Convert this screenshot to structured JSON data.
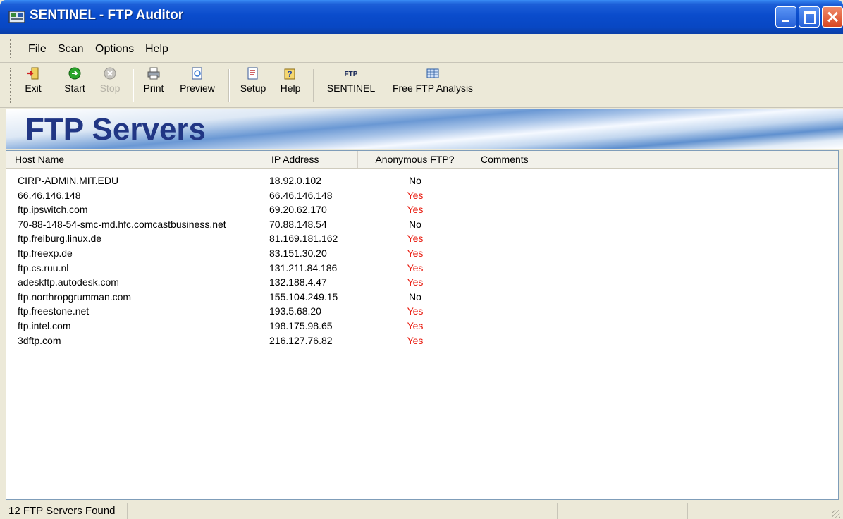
{
  "window": {
    "title": "SENTINEL - FTP Auditor"
  },
  "menu": [
    "File",
    "Scan",
    "Options",
    "Help"
  ],
  "toolbar": [
    {
      "label": "Exit",
      "icon": "exit-icon",
      "enabled": true
    },
    {
      "label": "Start",
      "icon": "start-icon",
      "enabled": true
    },
    {
      "label": "Stop",
      "icon": "stop-icon",
      "enabled": false
    },
    {
      "label": "Print",
      "icon": "print-icon",
      "enabled": true
    },
    {
      "label": "Preview",
      "icon": "preview-icon",
      "enabled": true
    },
    {
      "label": "Setup",
      "icon": "setup-icon",
      "enabled": true
    },
    {
      "label": "Help",
      "icon": "help-icon",
      "enabled": true
    },
    {
      "label": "SENTINEL",
      "icon": "ftp-icon",
      "enabled": true
    },
    {
      "label": "Free FTP Analysis",
      "icon": "analysis-icon",
      "enabled": true
    }
  ],
  "banner": {
    "title": "FTP Servers"
  },
  "columns": [
    "Host Name",
    "IP Address",
    "Anonymous FTP?",
    "Comments"
  ],
  "rows": [
    {
      "host": "CIRP-ADMIN.MIT.EDU",
      "ip": "18.92.0.102",
      "anon": "No"
    },
    {
      "host": "66.46.146.148",
      "ip": "66.46.146.148",
      "anon": "Yes"
    },
    {
      "host": "ftp.ipswitch.com",
      "ip": "69.20.62.170",
      "anon": "Yes"
    },
    {
      "host": "70-88-148-54-smc-md.hfc.comcastbusiness.net",
      "ip": "70.88.148.54",
      "anon": "No"
    },
    {
      "host": "ftp.freiburg.linux.de",
      "ip": "81.169.181.162",
      "anon": "Yes"
    },
    {
      "host": "ftp.freexp.de",
      "ip": "83.151.30.20",
      "anon": "Yes"
    },
    {
      "host": "ftp.cs.ruu.nl",
      "ip": "131.211.84.186",
      "anon": "Yes"
    },
    {
      "host": "adeskftp.autodesk.com",
      "ip": "132.188.4.47",
      "anon": "Yes"
    },
    {
      "host": "ftp.northropgrumman.com",
      "ip": "155.104.249.15",
      "anon": "No"
    },
    {
      "host": "ftp.freestone.net",
      "ip": "193.5.68.20",
      "anon": "Yes"
    },
    {
      "host": "ftp.intel.com",
      "ip": "198.175.98.65",
      "anon": "Yes"
    },
    {
      "host": "3dftp.com",
      "ip": "216.127.76.82",
      "anon": "Yes"
    }
  ],
  "status": {
    "text": "12 FTP Servers Found"
  },
  "colors": {
    "yes": "#e8180c",
    "banner_title": "#213684",
    "titlebar": "#0a4ccc"
  }
}
